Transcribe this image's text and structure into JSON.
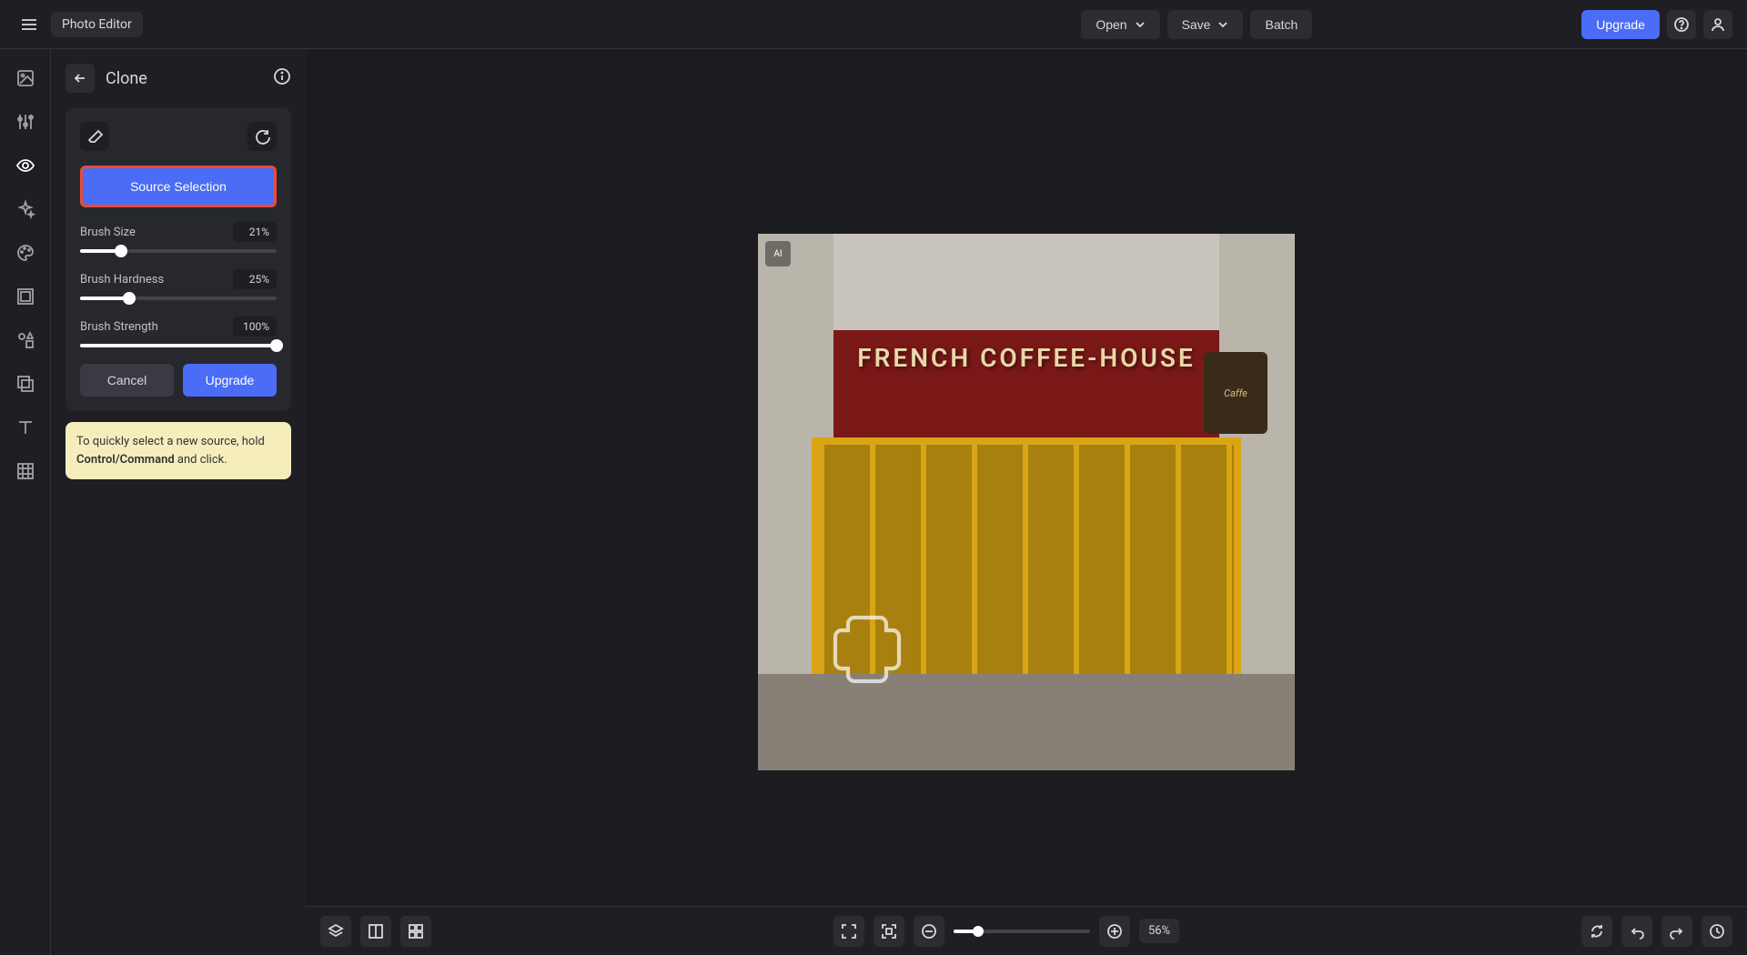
{
  "header": {
    "app_title": "Photo Editor",
    "open_label": "Open",
    "save_label": "Save",
    "batch_label": "Batch",
    "upgrade_label": "Upgrade"
  },
  "panel": {
    "title": "Clone",
    "source_selection_label": "Source Selection",
    "sliders": {
      "size": {
        "label": "Brush Size",
        "value": "21%",
        "percent": 21
      },
      "hardness": {
        "label": "Brush Hardness",
        "value": "25%",
        "percent": 25
      },
      "strength": {
        "label": "Brush Strength",
        "value": "100%",
        "percent": 100
      }
    },
    "cancel_label": "Cancel",
    "upgrade_label": "Upgrade",
    "tip_prefix": "To quickly select a new source, hold ",
    "tip_bold": "Control/Command",
    "tip_suffix": " and click."
  },
  "canvas": {
    "sign_text": "FRENCH COFFEE-HOUSE",
    "hanging_sign_text": "Caffe",
    "ai_badge": "AI"
  },
  "footer": {
    "zoom_value": "56%"
  },
  "colors": {
    "accent": "#4a6cf7",
    "highlight_border": "#e74c3c",
    "tip_bg": "#f5eebc"
  }
}
